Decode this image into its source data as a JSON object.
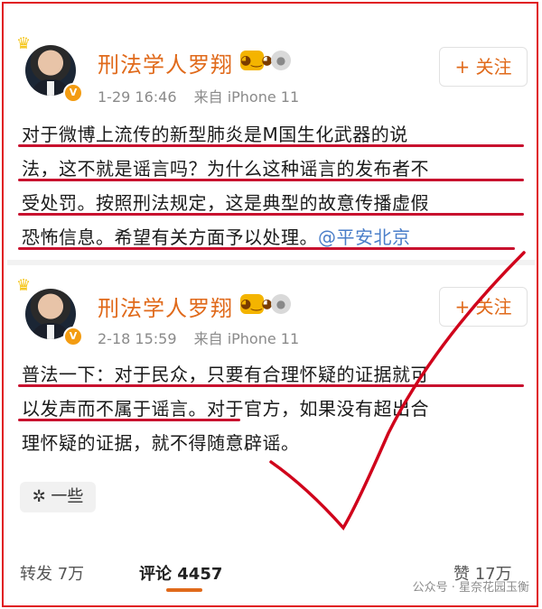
{
  "post1": {
    "author": "刑法学人罗翔",
    "verified_mark": "V",
    "badge_icon": "owl-badge-icon",
    "follow_label": "+ 关注",
    "date": "1-29 16:46",
    "source": "来自 iPhone 11",
    "text_lines": [
      "对于微博上流传的新型肺炎是M国生化武器的说",
      "法，这不就是谣言吗？为什么这种谣言的发布者不",
      "受处罚。按照刑法规定，这是典型的故意传播虚假",
      "恐怖信息。希望有关方面予以处理。"
    ],
    "mention": "@平安北京"
  },
  "post2": {
    "author": "刑法学人罗翔",
    "verified_mark": "V",
    "badge_icon": "owl-badge-icon",
    "follow_label": "+ 关注",
    "date": "2-18 15:59",
    "source": "来自 iPhone 11",
    "text_lines": [
      "普法一下：对于民众，只要有合理怀疑的证据就可",
      "以发声而不属于谣言。对于官方，如果没有超出合",
      "理怀疑的证据，就不得随意辟谣。"
    ],
    "more_label": "✲ 一些"
  },
  "actions": {
    "repost": "转发 7万",
    "comment": "评论 4457",
    "like": "赞 17万"
  },
  "watermark": "公众号 · 星奈花园玉衡",
  "colors": {
    "accent": "#e06a1b",
    "annotation": "#c8102e",
    "link": "#4a7ec9"
  }
}
